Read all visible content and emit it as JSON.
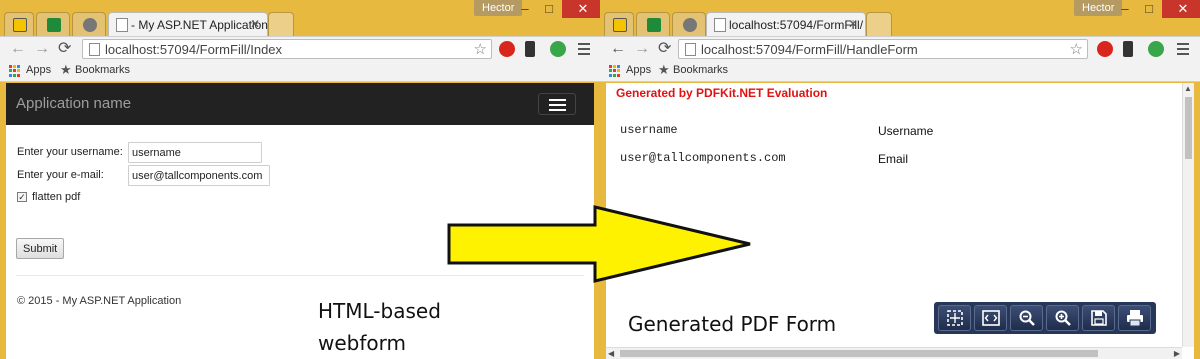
{
  "left_window": {
    "user_name": "Hector",
    "tab_title": "- My ASP.NET Application",
    "url": "localhost:57094/FormFill/Index",
    "bookmarks": {
      "apps": "Apps",
      "bookmarks": "Bookmarks"
    },
    "app": {
      "brand": "Application name",
      "form": {
        "username_label": "Enter your username:",
        "username_value": "username",
        "email_label": "Enter your e-mail:",
        "email_value": "user@tallcomponents.com",
        "flatten_checked": true,
        "flatten_label": "flatten pdf",
        "submit_label": "Submit"
      },
      "footer": "© 2015 - My ASP.NET Application"
    }
  },
  "right_window": {
    "user_name": "Hector",
    "tab_title": "localhost:57094/FormFill/",
    "url": "localhost:57094/FormFill/HandleForm",
    "bookmarks": {
      "apps": "Apps",
      "bookmarks": "Bookmarks"
    },
    "pdf": {
      "evaluation_banner": "Generated by PDFKit.NET Evaluation",
      "fields": [
        {
          "value": "username",
          "label": "Username"
        },
        {
          "value": "user@tallcomponents.com",
          "label": "Email"
        }
      ],
      "toolbar_icons": [
        "fit-page-icon",
        "fit-width-icon",
        "zoom-out-icon",
        "zoom-in-icon",
        "save-icon",
        "print-icon"
      ]
    }
  },
  "annotations": {
    "left_caption_line1": "HTML-based",
    "left_caption_line2": "webform",
    "right_caption": "Generated PDF Form"
  },
  "colors": {
    "window_frame": "#e8b93f",
    "app_navbar": "#222222",
    "pdf_banner": "#e01212",
    "arrow_fill": "#fff200",
    "pdf_toolbar": "#27375a"
  }
}
